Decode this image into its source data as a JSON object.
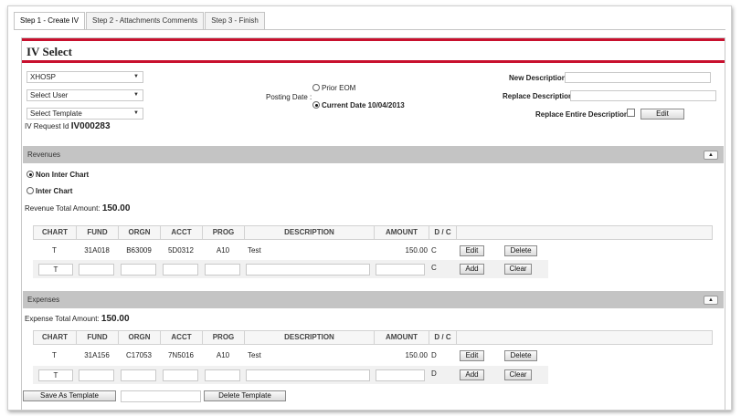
{
  "tabs": [
    "Step 1 - Create IV",
    "Step 2 - Attachments Comments",
    "Step 3 - Finish"
  ],
  "panel_title": "IV Select",
  "selects": {
    "org": "XHOSP",
    "user": "Select User",
    "template": "Select Template"
  },
  "request": {
    "label": "IV Request Id",
    "value": "IV000283"
  },
  "posting": {
    "label": "Posting Date :",
    "prior": "Prior EOM",
    "current": "Current Date 10/04/2013"
  },
  "desc": {
    "new_label": "New Description",
    "replace_label": "Replace Description",
    "replace_entire_label": "Replace Entire Description",
    "edit": "Edit"
  },
  "revenues": {
    "title": "Revenues",
    "non_inter": "Non Inter Chart",
    "inter": "Inter Chart",
    "total_label": "Revenue Total Amount:",
    "total_value": "150.00",
    "row": {
      "chart": "T",
      "fund": "31A018",
      "orgn": "B63009",
      "acct": "5D0312",
      "prog": "A10",
      "description": "Test",
      "amount": "150.00",
      "dc": "C"
    },
    "new_row": {
      "chart": "T",
      "dc": "C"
    }
  },
  "expenses": {
    "title": "Expenses",
    "total_label": "Expense Total Amount:",
    "total_value": "150.00",
    "row": {
      "chart": "T",
      "fund": "31A156",
      "orgn": "C17053",
      "acct": "7N5016",
      "prog": "A10",
      "description": "Test",
      "amount": "150.00",
      "dc": "D"
    },
    "new_row": {
      "chart": "T",
      "dc": "D"
    }
  },
  "columns": {
    "chart": "CHART",
    "fund": "FUND",
    "orgn": "ORGN",
    "acct": "ACCT",
    "prog": "PROG",
    "description": "DESCRIPTION",
    "amount": "AMOUNT",
    "dc": "D / C"
  },
  "buttons": {
    "edit": "Edit",
    "delete": "Delete",
    "add": "Add",
    "clear": "Clear",
    "save_template": "Save As Template",
    "delete_template": "Delete Template"
  },
  "icons": {
    "dropdown": "chevron-down-icon",
    "collapse": "collapse-up-icon"
  },
  "colors": {
    "accent_red": "#c8102e",
    "section_gray": "#c4c4c4"
  }
}
